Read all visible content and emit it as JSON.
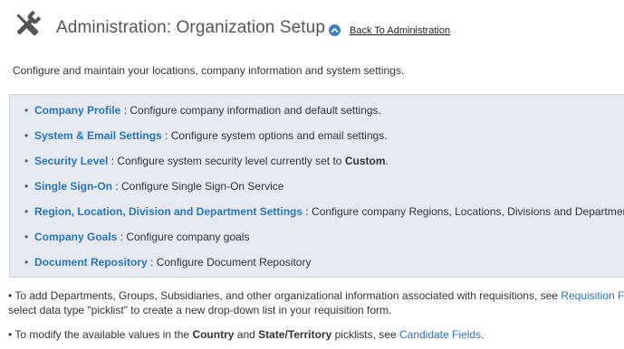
{
  "header": {
    "title": "Administration: Organization Setup",
    "back_link": "Back To Administration",
    "icon": "tools-icon",
    "back_icon": "chevron-up-circle-icon"
  },
  "intro": "Configure and maintain your locations, company information and system settings.",
  "items": [
    {
      "link": "Company Profile",
      "sep": " : ",
      "desc": "Configure company information and default settings."
    },
    {
      "link": "System & Email Settings",
      "sep": " : ",
      "desc": "Configure system options and email settings."
    },
    {
      "link": "Security Level",
      "sep": " : ",
      "desc_before": "Configure system security level currently set to ",
      "desc_bold": "Custom",
      "desc_after": "."
    },
    {
      "link": "Single Sign-On",
      "sep": " : ",
      "desc": "Configure Single Sign-On Service"
    },
    {
      "link": "Region, Location, Division and Department Settings",
      "sep": " : ",
      "desc": "Configure company Regions, Locations, Divisions and Departments"
    },
    {
      "link": "Company Goals",
      "sep": " : ",
      "desc": "Configure company goals"
    },
    {
      "link": "Document Repository",
      "sep": " : ",
      "desc": "Configure Document Repository"
    }
  ],
  "notes": {
    "first": {
      "prefix": "• To add Departments, Groups, Subsidiaries, and other organizational information associated with requisitions, see ",
      "link": "Requisition F",
      "line2": "select data type \"picklist\" to create a new drop-down list in your requisition form."
    },
    "second": {
      "prefix": "• To modify the available values in the ",
      "bold1": "Country",
      "mid": " and ",
      "bold2": "State/Territory",
      "middle2": " picklists, see ",
      "link": "Candidate Fields",
      "suffix": "."
    }
  },
  "colors": {
    "link": "#2a74b8",
    "panel_bg": "#e6ebf3",
    "back_icon": "#3b7fc4"
  }
}
